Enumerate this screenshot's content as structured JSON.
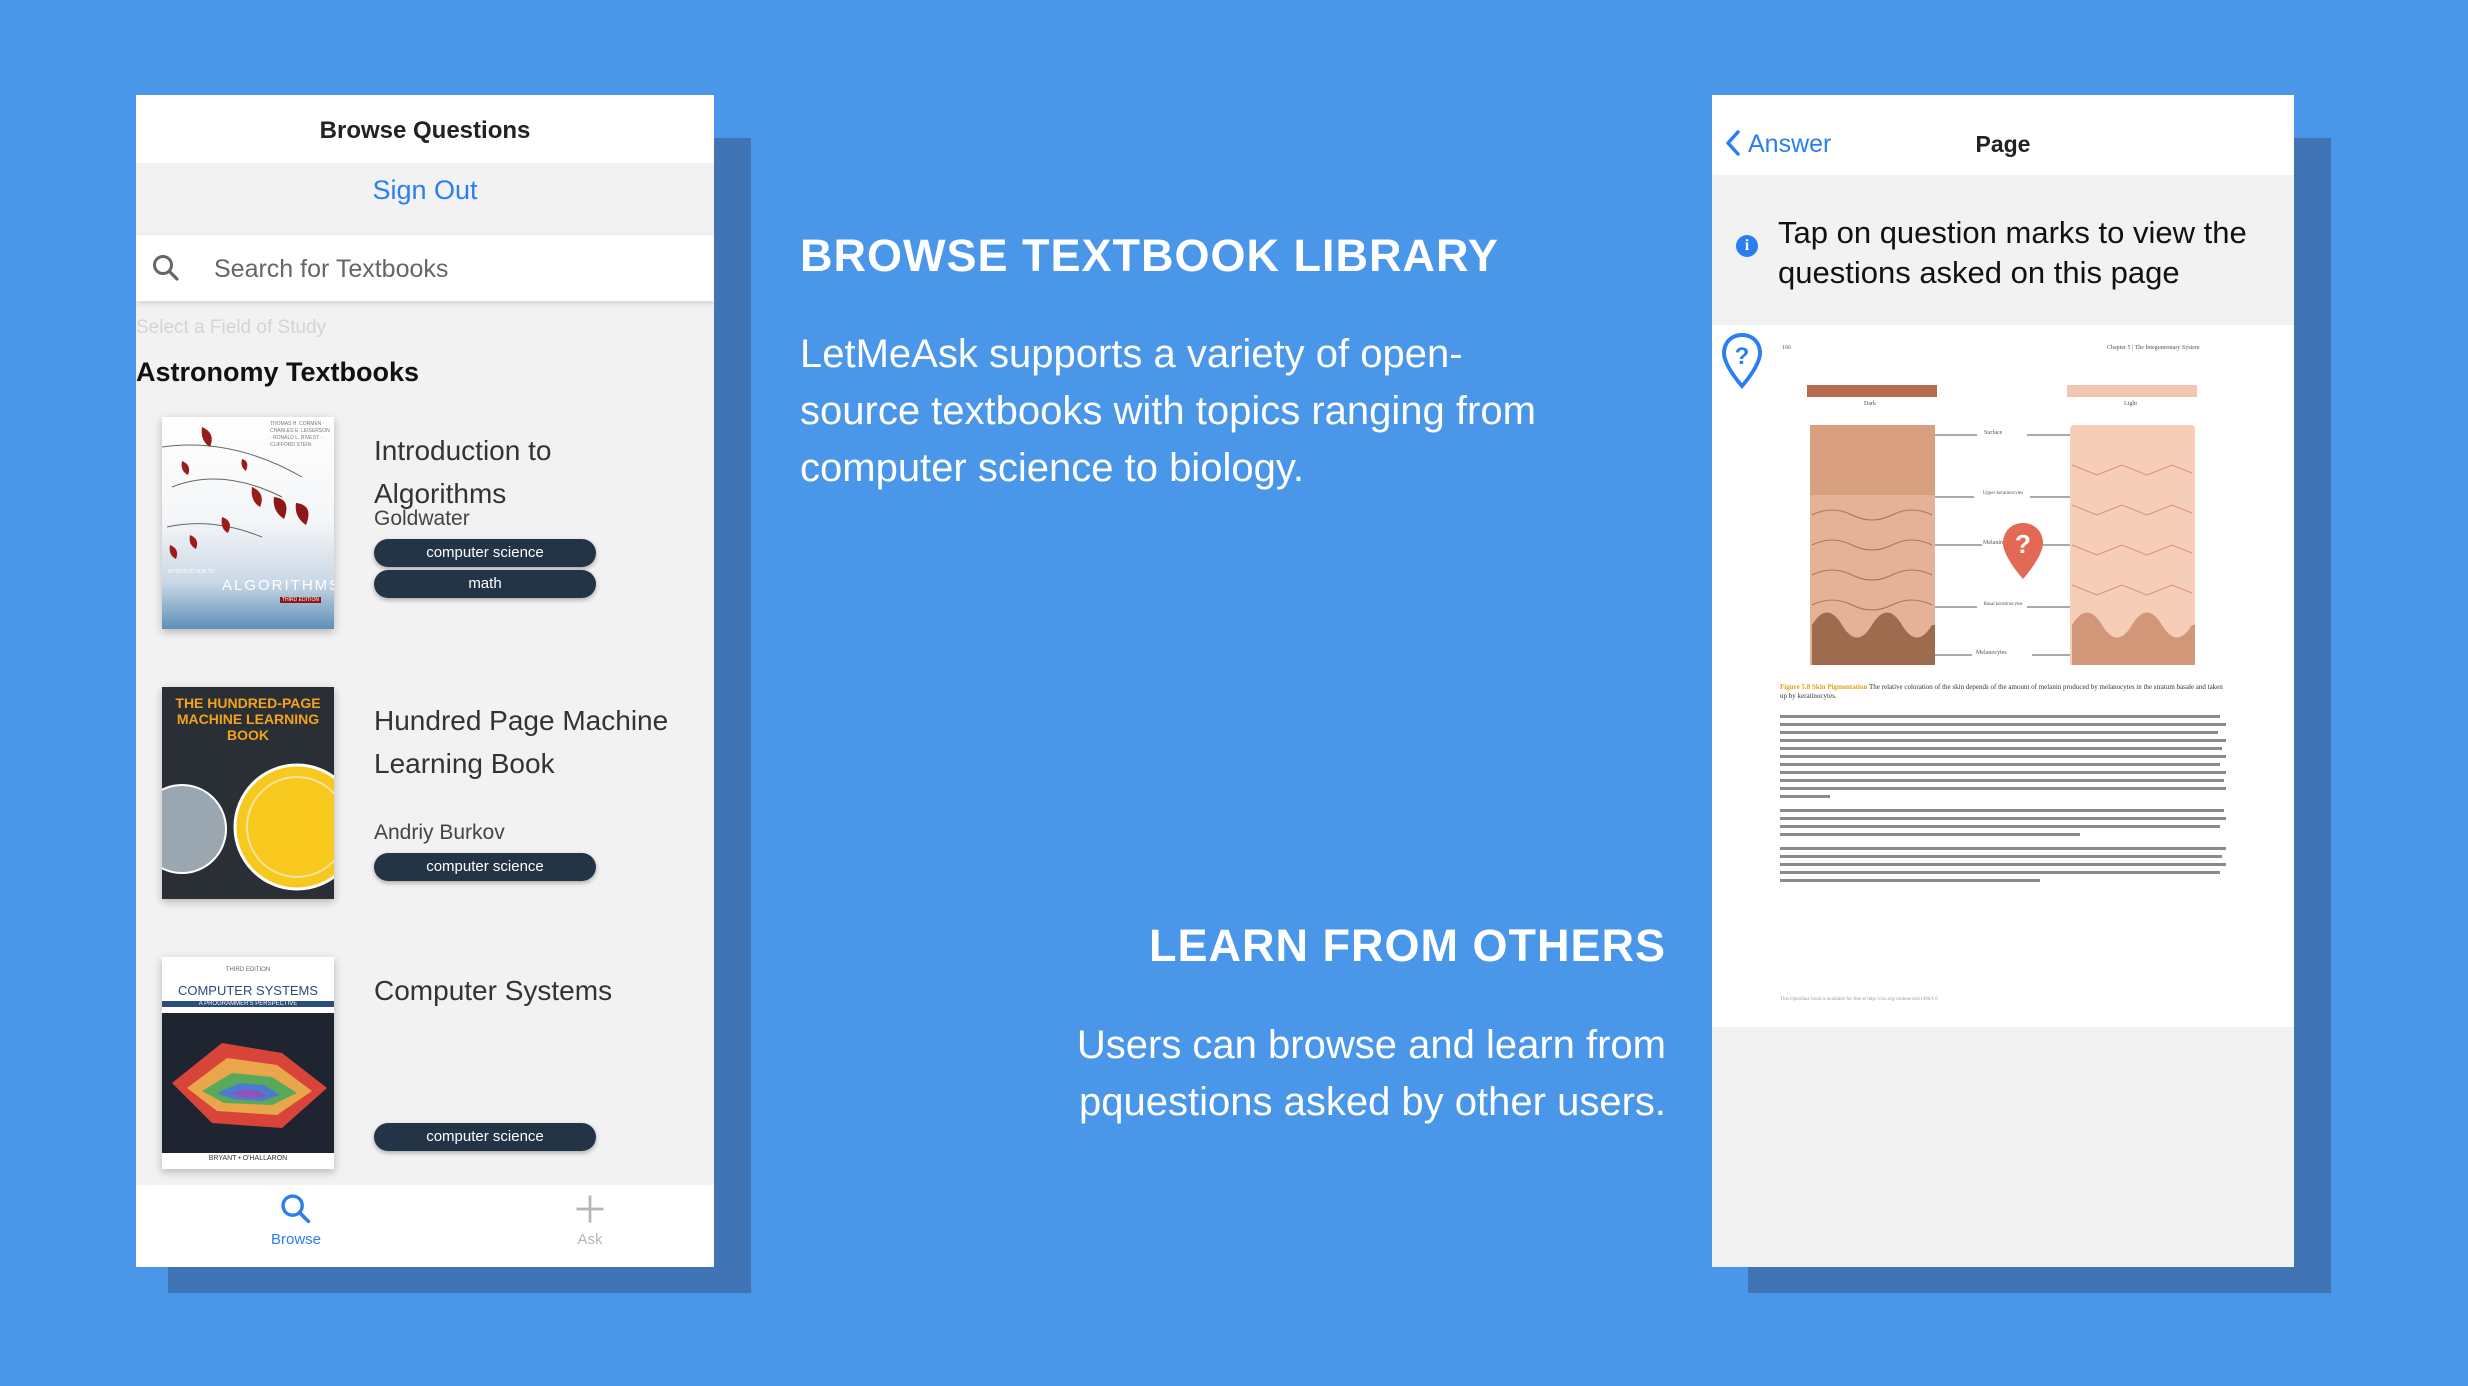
{
  "left_phone": {
    "title": "Browse Questions",
    "sign_out": "Sign Out",
    "search_placeholder": "Search for Textbooks",
    "field_label": "Select a Field of Study",
    "section": "Astronomy Textbooks",
    "books": [
      {
        "title": "Introduction to Algorithms",
        "author": "Goldwater",
        "tags": [
          "computer science",
          "math"
        ],
        "cover": {
          "series": "INTRODUCTION TO",
          "name": "ALGORITHMS",
          "edition": "THIRD EDITION",
          "authors": "THOMAS H. CORMEN · CHARLES E. LEISERSON · RONALD L. RIVEST · CLIFFORD STEIN"
        }
      },
      {
        "title": "Hundred Page Machine Learning Book",
        "author": "Andriy Burkov",
        "tags": [
          "computer science"
        ],
        "cover": {
          "name": "THE HUNDRED-PAGE MACHINE LEARNING BOOK"
        }
      },
      {
        "title": "Computer Systems",
        "author": "",
        "tags": [
          "computer science"
        ],
        "cover": {
          "edition": "THIRD EDITION",
          "name": "COMPUTER SYSTEMS",
          "subtitle": "A PROGRAMMER'S PERSPECTIVE",
          "authors": "BRYANT • O'HALLARON"
        }
      }
    ],
    "tabs": [
      {
        "label": "Browse",
        "icon": "search-icon",
        "active": true
      },
      {
        "label": "Ask",
        "icon": "plus-icon",
        "active": false
      }
    ],
    "colors": {
      "accent": "#2b7ef0",
      "tag": "#243447"
    }
  },
  "features": {
    "browse_heading": "BROWSE TEXTBOOK LIBRARY",
    "browse_text": "LetMeAsk supports a variety of open-source textbooks with topics ranging from computer science to biology.",
    "learn_heading": "LEARN FROM OTHERS",
    "learn_text": "Users can browse and learn from pquestions asked by other users."
  },
  "right_phone": {
    "back_label": "Answer",
    "title": "Page",
    "info_text": "Tap on question marks to view the questions asked on this page",
    "page": {
      "page_number": "166",
      "chapter": "Chapter 5 | The Integumentary System",
      "labels": {
        "dark": "Dark",
        "light": "Light",
        "surface": "Surface",
        "upper": "Upper keratinocytes",
        "melanin": "Melanin",
        "basal": "Basal keratinocytes",
        "melanocytes": "Melanocytes"
      },
      "caption_title": "Figure 5.8 Skin Pigmentation",
      "caption_text": "The relative coloration of the skin depends of the amount of melanin produced by melanocytes in the stratum basale and taken up by keratinocytes.",
      "footer": "This OpenStax book is available for free at http://cnx.org/content/col11496/1.6"
    },
    "colors": {
      "pin_blue": "#2b7ef0",
      "pin_red": "#e26a54"
    }
  },
  "colors": {
    "background": "#4a96e8",
    "shadow": "#4174b4"
  }
}
